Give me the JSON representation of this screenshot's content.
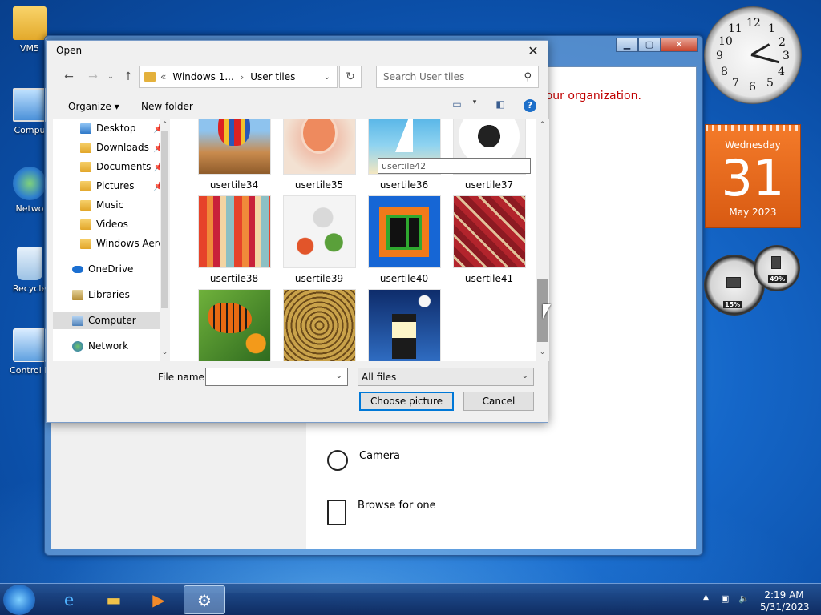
{
  "desktop": {
    "icons": [
      {
        "label": "VM5"
      },
      {
        "label": "Compu"
      },
      {
        "label": "Netwo"
      },
      {
        "label": "Recycle"
      },
      {
        "label": "Control P"
      }
    ]
  },
  "background_window": {
    "org_message": "ged by your organization.",
    "options": [
      {
        "label": "Camera",
        "icon": "camera-icon"
      },
      {
        "label": "Browse for one",
        "icon": "file-icon"
      }
    ]
  },
  "dialog": {
    "title": "Open",
    "close_glyph": "✕",
    "address": {
      "prefix": "«",
      "segments": [
        "Windows 1...",
        "User tiles"
      ]
    },
    "search_placeholder": "Search User tiles",
    "toolbar": {
      "organize": "Organize ▾",
      "new_folder": "New folder",
      "help": "?"
    },
    "nav_items": [
      {
        "label": "Desktop",
        "pinned": true
      },
      {
        "label": "Downloads",
        "pinned": true
      },
      {
        "label": "Documents",
        "pinned": true
      },
      {
        "label": "Pictures",
        "pinned": true
      },
      {
        "label": "Music",
        "pinned": false
      },
      {
        "label": "Videos",
        "pinned": false
      },
      {
        "label": "Windows Aero",
        "pinned": false
      },
      {
        "label": "OneDrive",
        "pinned": false
      },
      {
        "label": "Libraries",
        "pinned": false
      },
      {
        "label": "Computer",
        "pinned": false,
        "selected": true
      },
      {
        "label": "Network",
        "pinned": false
      }
    ],
    "files": [
      {
        "name": "usertile34"
      },
      {
        "name": "usertile35"
      },
      {
        "name": "usertile36"
      },
      {
        "name": "usertile37"
      },
      {
        "name": "usertile38"
      },
      {
        "name": "usertile39"
      },
      {
        "name": "usertile40"
      },
      {
        "name": "usertile41"
      },
      {
        "name": ""
      },
      {
        "name": ""
      },
      {
        "name": ""
      }
    ],
    "tooltip": "usertile42",
    "file_name_label": "File name:",
    "file_name_value": "",
    "filter_value": "All files",
    "choose_button": "Choose picture",
    "cancel_button": "Cancel"
  },
  "gadgets": {
    "clock_numbers": [
      "12",
      "1",
      "2",
      "3",
      "4",
      "5",
      "6",
      "7",
      "8",
      "9",
      "10",
      "11"
    ],
    "calendar": {
      "weekday": "Wednesday",
      "day": "31",
      "month": "May 2023"
    },
    "cpu_meter": {
      "cpu_percent": "15%",
      "memory_percent": "49%"
    }
  },
  "taskbar": {
    "time": "2:19 AM",
    "date": "5/31/2023"
  },
  "colors": {
    "accent": "#0078d7",
    "org_message": "#c00000",
    "calendar": "#e8641b"
  }
}
